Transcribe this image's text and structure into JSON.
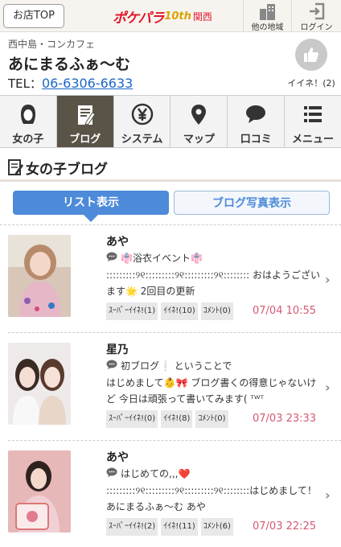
{
  "topbar": {
    "back_label": "お店TOP",
    "logo_text": "ポケパラ",
    "logo_badge": "10th",
    "logo_region": "関西",
    "area_label": "他の地域",
    "login_label": "ログイン"
  },
  "shop": {
    "area": "西中島・コンカフェ",
    "name": "あにまるふぁ〜む",
    "tel_prefix": "TEL：",
    "tel": "06-6306-6633",
    "like_label": "イイネ！(2)"
  },
  "nav": {
    "items": [
      {
        "label": "女の子",
        "icon": "girl-icon"
      },
      {
        "label": "ブログ",
        "icon": "blog-icon"
      },
      {
        "label": "システム",
        "icon": "yen-icon"
      },
      {
        "label": "マップ",
        "icon": "map-pin-icon"
      },
      {
        "label": "口コミ",
        "icon": "speech-bubble-icon"
      },
      {
        "label": "メニュー",
        "icon": "menu-list-icon"
      }
    ],
    "active_index": 1
  },
  "section": {
    "title": "女の子ブログ"
  },
  "toggles": {
    "list_label": "リスト表示",
    "photo_label": "ブログ写真表示"
  },
  "entries": [
    {
      "name": "あや",
      "title": "👘浴衣イベント👘",
      "body": ":::::::::୨୧:::::::::୨୧:::::::::୨୧:::::::: おはようございます🌟 2回目の更新",
      "super_like": "ｽｰﾊﾟｰｲｲﾈ!(1)",
      "like": "ｲｲﾈ!(10)",
      "comment": "ｺﾒﾝﾄ(0)",
      "date": "07/04 10:55"
    },
    {
      "name": "星乃",
      "title": "初ブログ❕ ということで",
      "body": "はじめまして👶🎀 ブログ書くの得意じゃないけど 今日は頑張って書いてみます( ᵀᵂᵀ",
      "super_like": "ｽｰﾊﾟｰｲｲﾈ!(0)",
      "like": "ｲｲﾈ!(8)",
      "comment": "ｺﾒﾝﾄ(0)",
      "date": "07/03 23:33"
    },
    {
      "name": "あや",
      "title": "はじめての,,,❤️",
      "body": ":::::::::୨୧:::::::::୨୧:::::::::୨୧::::::::はじめまして！あにまるふぁ〜む あや",
      "super_like": "ｽｰﾊﾟｰｲｲﾈ!(2)",
      "like": "ｲｲﾈ!(11)",
      "comment": "ｺﾒﾝﾄ(6)",
      "date": "07/03 22:25"
    }
  ],
  "colors": {
    "brand_red": "#e0162b",
    "nav_active": "#5a5348",
    "accent_blue": "#4d8ad9",
    "date_pink": "#d45a71"
  }
}
